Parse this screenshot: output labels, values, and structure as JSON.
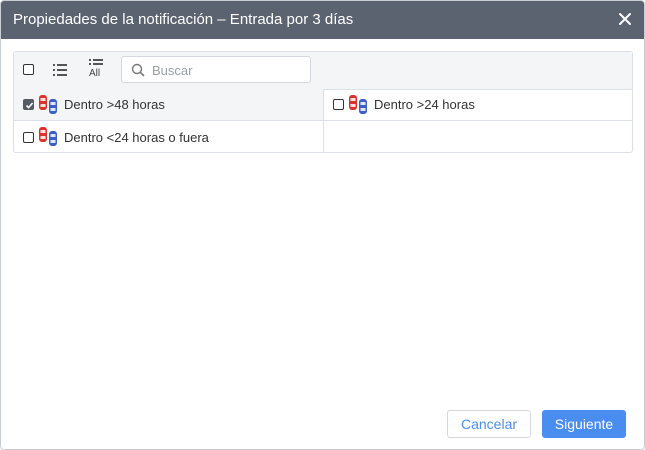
{
  "dialog": {
    "title": "Propiedades de la notificación – Entrada por 3 días"
  },
  "toolbar": {
    "icons": [
      "select-all-checkbox",
      "list-icon",
      "show-all-icon",
      "search-icon"
    ],
    "show_all_label": "All",
    "search_placeholder": "Buscar",
    "search_value": ""
  },
  "items": [
    {
      "label": "Dentro >48 horas",
      "checked": true
    },
    {
      "label": "Dentro >24 horas",
      "checked": false
    },
    {
      "label": "Dentro <24 horas o fuera",
      "checked": false
    }
  ],
  "buttons": {
    "cancel_label": "Cancelar",
    "next_label": "Siguiente"
  },
  "colors": {
    "titlebar": "#5c6370",
    "accent": "#4a8df0",
    "car_red": "#d9342b",
    "car_blue": "#3b5fc4"
  }
}
